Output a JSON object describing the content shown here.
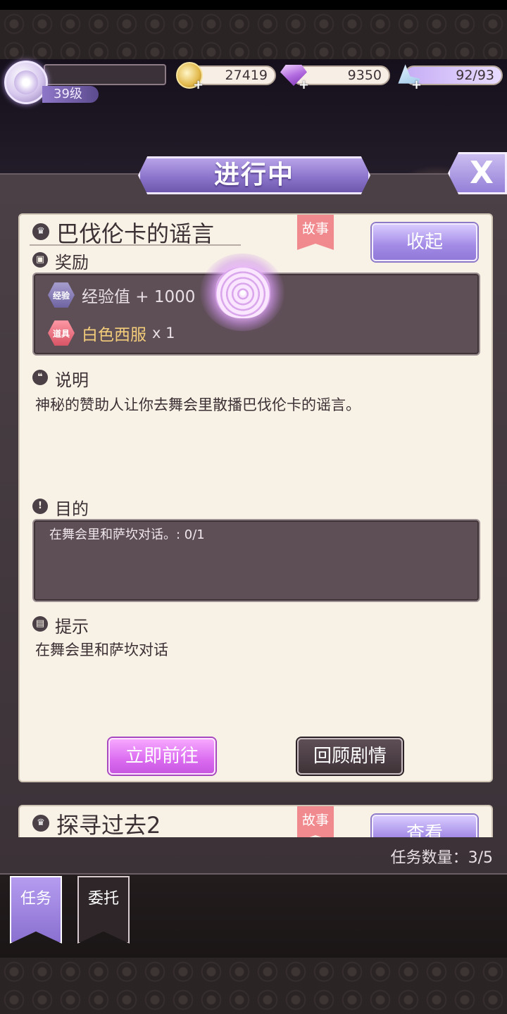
{
  "hud": {
    "level": "39级",
    "gold": "27419",
    "gems": "9350",
    "stamina": "92/93",
    "plus_symbol": "+"
  },
  "header": {
    "title": "进行中",
    "close_label": "X"
  },
  "quest_main": {
    "title": "巴伐伦卡的谣言",
    "tag": "故事",
    "collapse_label": "收起",
    "reward_label": "奖励",
    "rewards": [
      {
        "icon_label": "经验",
        "text": "经验值 + 1000"
      },
      {
        "icon_label": "道具",
        "name": "白色西服",
        "qty": "x 1"
      }
    ],
    "desc_label": "说明",
    "desc_text": "神秘的赞助人让你去舞会里散播巴伐伦卡的谣言。",
    "goal_label": "目的",
    "goal_text": "在舞会里和萨坎对话。: 0/1",
    "hint_label": "提示",
    "hint_text": "在舞会里和萨坎对话",
    "go_label": "立即前往",
    "review_label": "回顾剧情"
  },
  "quest_next": {
    "title": "探寻过去2",
    "tag": "故事",
    "view_label": "查看"
  },
  "footer": {
    "mission_count": "任务数量：3/5"
  },
  "tabs": [
    {
      "label": "任务"
    },
    {
      "label": "委托"
    }
  ],
  "colors": {
    "accent_purple": "#9079d8",
    "card_bg": "#f8f2e6",
    "story_tag": "#f08a8e",
    "go_button": "#db6cf0"
  }
}
